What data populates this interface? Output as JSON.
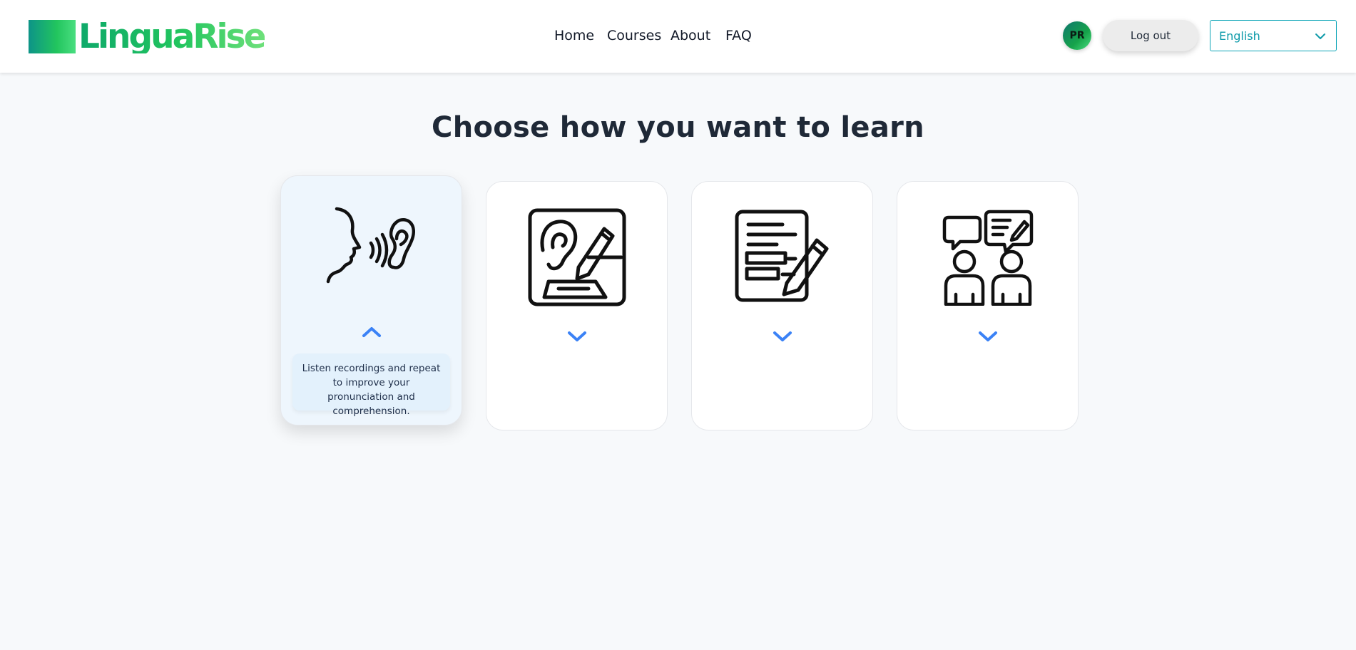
{
  "brand": {
    "name": "LinguaRise"
  },
  "nav": {
    "home": "Home",
    "courses": "Courses",
    "about": "About",
    "faq": "FAQ"
  },
  "user": {
    "initials": "PR",
    "logout_label": "Log out"
  },
  "language_select": {
    "selected": "English"
  },
  "main": {
    "title": "Choose how you want to learn",
    "cards": [
      {
        "icon": "speaking-listening-icon",
        "expanded": true,
        "description": "Listen recordings and repeat to improve your pronunciation and comprehension."
      },
      {
        "icon": "listen-write-icon",
        "expanded": false
      },
      {
        "icon": "document-writing-icon",
        "expanded": false
      },
      {
        "icon": "conversation-people-icon",
        "expanded": false
      }
    ]
  },
  "colors": {
    "accent_blue": "#3b82f6",
    "brand_green": "#22c55e",
    "brand_teal": "#0d9488",
    "lang_teal": "#0e9aa9"
  }
}
